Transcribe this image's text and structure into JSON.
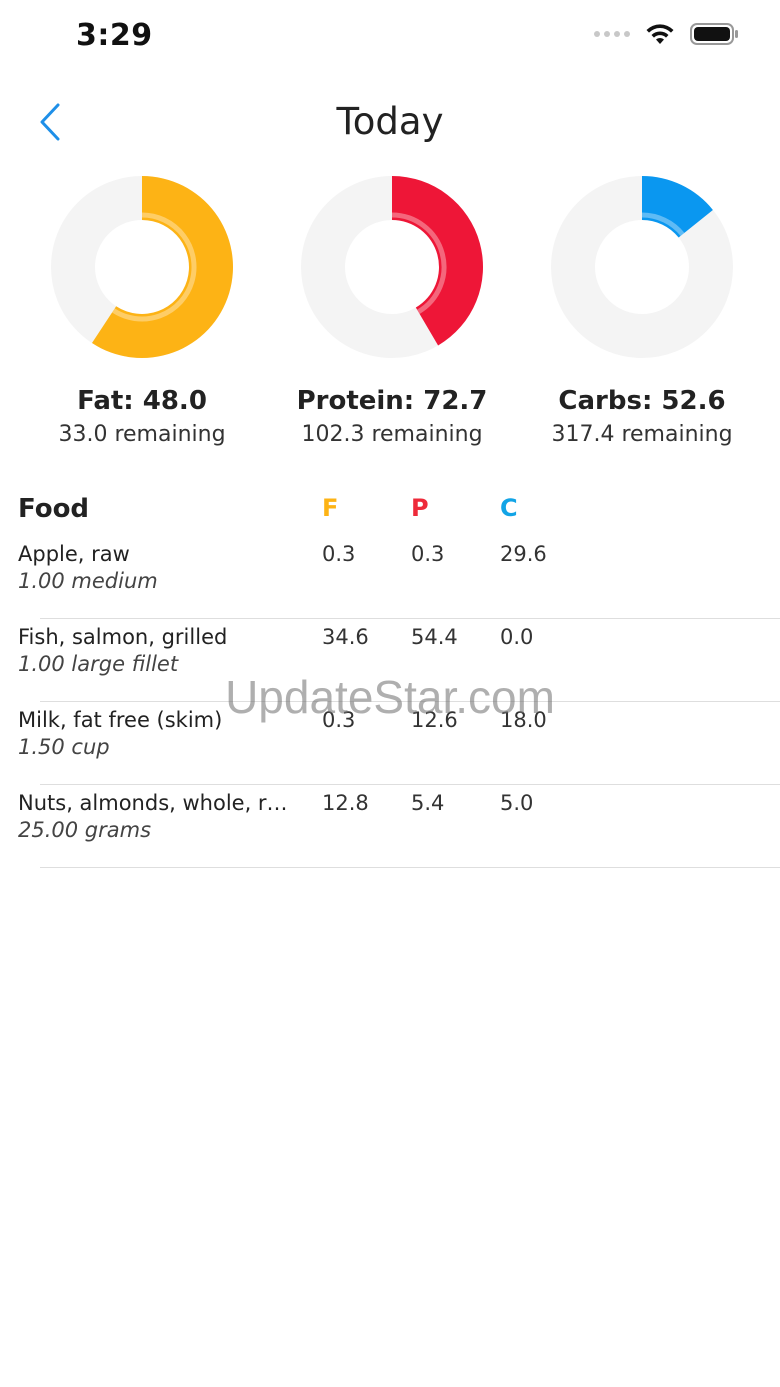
{
  "status_bar": {
    "time": "3:29"
  },
  "nav": {
    "title": "Today",
    "back_icon": "chevron-left-icon"
  },
  "colors": {
    "fat": "#FDB315",
    "protein": "#EE1637",
    "carbs": "#0A97F0",
    "ring_track": "#F4F4F4",
    "header_f": "#FDB315",
    "header_p": "#EE2A3A",
    "header_c": "#12A4E6",
    "nav_accent": "#1E8FE8"
  },
  "macros": [
    {
      "key": "fat",
      "label": "Fat: 48.0",
      "remaining": "33.0 remaining",
      "consumed": 48.0,
      "remaining_value": 33.0
    },
    {
      "key": "protein",
      "label": "Protein: 72.7",
      "remaining": "102.3 remaining",
      "consumed": 72.7,
      "remaining_value": 102.3
    },
    {
      "key": "carbs",
      "label": "Carbs: 52.6",
      "remaining": "317.4 remaining",
      "consumed": 52.6,
      "remaining_value": 317.4
    }
  ],
  "table": {
    "headers": {
      "food": "Food",
      "f": "F",
      "p": "P",
      "c": "C"
    },
    "rows": [
      {
        "name": "Apple, raw",
        "qty": "1.00 medium",
        "f": "0.3",
        "p": "0.3",
        "c": "29.6"
      },
      {
        "name": "Fish, salmon, grilled",
        "qty": "1.00 large fillet",
        "f": "34.6",
        "p": "54.4",
        "c": "0.0"
      },
      {
        "name": "Milk, fat free (skim)",
        "qty": "1.50 cup",
        "f": "0.3",
        "p": "12.6",
        "c": "18.0"
      },
      {
        "name": "Nuts, almonds, whole, r…",
        "qty": "25.00 grams",
        "f": "12.8",
        "p": "5.4",
        "c": "5.0"
      }
    ]
  },
  "watermark": "UpdateStar.com"
}
